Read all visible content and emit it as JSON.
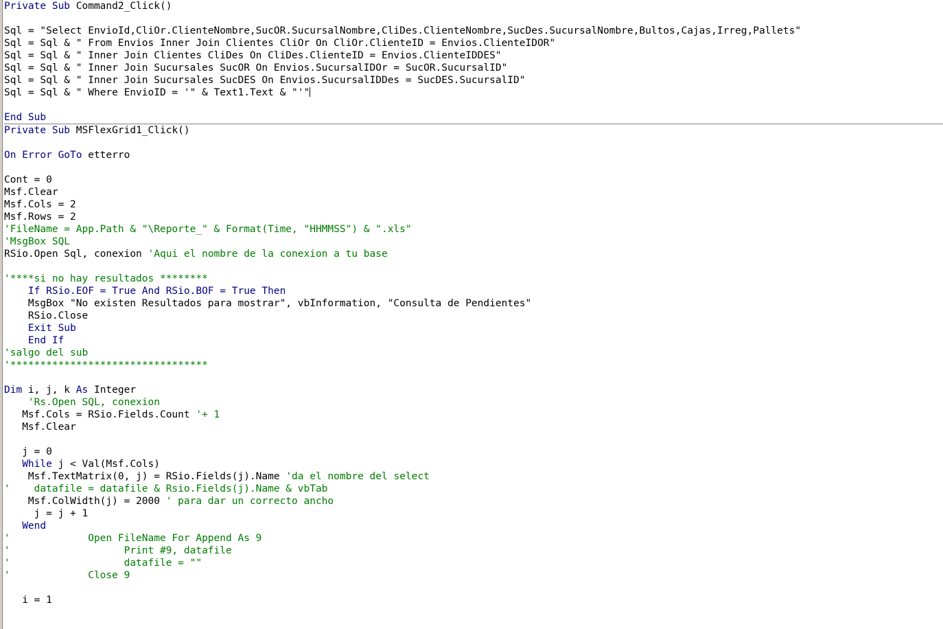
{
  "window": {
    "title": "Code",
    "background": "#ffffff",
    "margin_bar_color": "#d4d0c8",
    "keyword_color": "#00007f",
    "comment_color": "#007c00",
    "text_color": "#000000"
  },
  "editor": {
    "language": "Visual Basic 6",
    "line_height_px": 18,
    "caret_line": 7,
    "caret_visible": true
  },
  "procedures": [
    {
      "name": "Command2_Click",
      "declaration": "Private Sub Command2_Click()",
      "lines": [
        {
          "n": 1,
          "segments": [
            {
              "t": "Private Sub ",
              "c": "kw"
            },
            {
              "t": "Command2_Click()",
              "c": "txt"
            }
          ]
        },
        {
          "n": 2,
          "segments": [
            {
              "t": "",
              "c": "txt"
            }
          ]
        },
        {
          "n": 3,
          "segments": [
            {
              "t": "Sql = \"Select EnvioId,CliOr.ClienteNombre,SucOR.SucursalNombre,CliDes.ClienteNombre,SucDes.SucursalNombre,Bultos,Cajas,Irreg,Pallets\"",
              "c": "txt"
            }
          ]
        },
        {
          "n": 4,
          "segments": [
            {
              "t": "Sql = Sql & \" From Envios Inner Join Clientes CliOr On CliOr.ClienteID = Envios.ClienteIDOR\"",
              "c": "txt"
            }
          ]
        },
        {
          "n": 5,
          "segments": [
            {
              "t": "Sql = Sql & \" Inner Join Clientes CliDes On CliDes.ClienteID = Envios.ClienteIDDES\"",
              "c": "txt"
            }
          ]
        },
        {
          "n": 6,
          "segments": [
            {
              "t": "Sql = Sql & \" Inner Join Sucursales SucOR On Envios.SucursalIDOr = SucOR.SucursalID\"",
              "c": "txt"
            }
          ]
        },
        {
          "n": 7,
          "segments": [
            {
              "t": "Sql = Sql & \" Inner Join Sucursales SucDES On Envios.SucursalIDDes = SucDES.SucursalID\"",
              "c": "txt"
            }
          ]
        },
        {
          "n": 8,
          "segments": [
            {
              "t": "Sql = Sql & \" Where EnvioID = '\" & Text1.Text & \"'\"",
              "c": "txt"
            }
          ],
          "caret": true
        },
        {
          "n": 9,
          "segments": [
            {
              "t": "",
              "c": "txt"
            }
          ]
        },
        {
          "n": 10,
          "segments": [
            {
              "t": "End Sub",
              "c": "kw"
            }
          ]
        }
      ]
    },
    {
      "name": "MSFlexGrid1_Click",
      "declaration": "Private Sub MSFlexGrid1_Click()",
      "lines": [
        {
          "n": 1,
          "segments": [
            {
              "t": "Private Sub ",
              "c": "kw"
            },
            {
              "t": "MSFlexGrid1_Click()",
              "c": "txt"
            }
          ]
        },
        {
          "n": 2,
          "segments": [
            {
              "t": "",
              "c": "txt"
            }
          ]
        },
        {
          "n": 3,
          "segments": [
            {
              "t": "On Error GoTo ",
              "c": "kw"
            },
            {
              "t": "etterro",
              "c": "txt"
            }
          ]
        },
        {
          "n": 4,
          "segments": [
            {
              "t": "",
              "c": "txt"
            }
          ]
        },
        {
          "n": 5,
          "segments": [
            {
              "t": "Cont = 0",
              "c": "txt"
            }
          ]
        },
        {
          "n": 6,
          "segments": [
            {
              "t": "Msf.Clear",
              "c": "txt"
            }
          ]
        },
        {
          "n": 7,
          "segments": [
            {
              "t": "Msf.Cols = 2",
              "c": "txt"
            }
          ]
        },
        {
          "n": 8,
          "segments": [
            {
              "t": "Msf.Rows = 2",
              "c": "txt"
            }
          ]
        },
        {
          "n": 9,
          "segments": [
            {
              "t": "'FileName = App.Path & \"\\Reporte_\" & Format(Time, \"HHMMSS\") & \".xls\"",
              "c": "cmt"
            }
          ]
        },
        {
          "n": 10,
          "segments": [
            {
              "t": "'MsgBox SQL",
              "c": "cmt"
            }
          ]
        },
        {
          "n": 11,
          "segments": [
            {
              "t": "RSio.Open Sql, conexion ",
              "c": "txt"
            },
            {
              "t": "'Aqui el nombre de la conexion a tu base",
              "c": "cmt"
            }
          ]
        },
        {
          "n": 12,
          "segments": [
            {
              "t": "",
              "c": "txt"
            }
          ]
        },
        {
          "n": 13,
          "segments": [
            {
              "t": "'****si no hay resultados ********",
              "c": "cmt"
            }
          ]
        },
        {
          "n": 14,
          "segments": [
            {
              "t": "    If RSio.EOF = True And RSio.BOF = True Then",
              "c": "kw"
            }
          ]
        },
        {
          "n": 15,
          "segments": [
            {
              "t": "    MsgBox \"No existen Resultados para mostrar\", vbInformation, \"Consulta de Pendientes\"",
              "c": "txt"
            }
          ]
        },
        {
          "n": 16,
          "segments": [
            {
              "t": "    RSio.Close",
              "c": "txt"
            }
          ]
        },
        {
          "n": 17,
          "segments": [
            {
              "t": "    Exit Sub",
              "c": "kw"
            }
          ]
        },
        {
          "n": 18,
          "segments": [
            {
              "t": "    End If",
              "c": "kw"
            }
          ]
        },
        {
          "n": 19,
          "segments": [
            {
              "t": "'salgo del sub",
              "c": "cmt"
            }
          ]
        },
        {
          "n": 20,
          "segments": [
            {
              "t": "'*********************************",
              "c": "cmt"
            }
          ]
        },
        {
          "n": 21,
          "segments": [
            {
              "t": "",
              "c": "txt"
            }
          ]
        },
        {
          "n": 22,
          "segments": [
            {
              "t": "Dim ",
              "c": "kw"
            },
            {
              "t": "i, j, k ",
              "c": "txt"
            },
            {
              "t": "As ",
              "c": "kw"
            },
            {
              "t": "Integer",
              "c": "txt"
            }
          ]
        },
        {
          "n": 23,
          "segments": [
            {
              "t": "    'Rs.Open SQL, conexion",
              "c": "cmt"
            }
          ]
        },
        {
          "n": 24,
          "segments": [
            {
              "t": "   Msf.Cols = RSio.Fields.Count ",
              "c": "txt"
            },
            {
              "t": "'+ 1",
              "c": "cmt"
            }
          ]
        },
        {
          "n": 25,
          "segments": [
            {
              "t": "   Msf.Clear",
              "c": "txt"
            }
          ]
        },
        {
          "n": 26,
          "segments": [
            {
              "t": "",
              "c": "txt"
            }
          ]
        },
        {
          "n": 27,
          "segments": [
            {
              "t": "   j = 0",
              "c": "txt"
            }
          ]
        },
        {
          "n": 28,
          "segments": [
            {
              "t": "   While ",
              "c": "kw"
            },
            {
              "t": "j < Val(Msf.Cols)",
              "c": "txt"
            }
          ]
        },
        {
          "n": 29,
          "segments": [
            {
              "t": "    Msf.TextMatrix(0, j) = RSio.Fields(j).Name ",
              "c": "txt"
            },
            {
              "t": "'da el nombre del select",
              "c": "cmt"
            }
          ]
        },
        {
          "n": 30,
          "segments": [
            {
              "t": "'    datafile = datafile & Rsio.Fields(j).Name & vbTab",
              "c": "cmt"
            }
          ]
        },
        {
          "n": 31,
          "segments": [
            {
              "t": "    Msf.ColWidth(j) = 2000 ",
              "c": "txt"
            },
            {
              "t": "' para dar un correcto ancho",
              "c": "cmt"
            }
          ]
        },
        {
          "n": 32,
          "segments": [
            {
              "t": "     j = j + 1",
              "c": "txt"
            }
          ]
        },
        {
          "n": 33,
          "segments": [
            {
              "t": "   Wend",
              "c": "kw"
            }
          ]
        },
        {
          "n": 34,
          "segments": [
            {
              "t": "'             Open FileName For Append As 9",
              "c": "cmt"
            }
          ]
        },
        {
          "n": 35,
          "segments": [
            {
              "t": "'                   Print #9, datafile",
              "c": "cmt"
            }
          ]
        },
        {
          "n": 36,
          "segments": [
            {
              "t": "'                   datafile = \"\"",
              "c": "cmt"
            }
          ]
        },
        {
          "n": 37,
          "segments": [
            {
              "t": "'             Close 9",
              "c": "cmt"
            }
          ]
        },
        {
          "n": 38,
          "segments": [
            {
              "t": "",
              "c": "txt"
            }
          ]
        },
        {
          "n": 39,
          "segments": [
            {
              "t": "   i = 1",
              "c": "txt"
            }
          ]
        }
      ]
    }
  ]
}
